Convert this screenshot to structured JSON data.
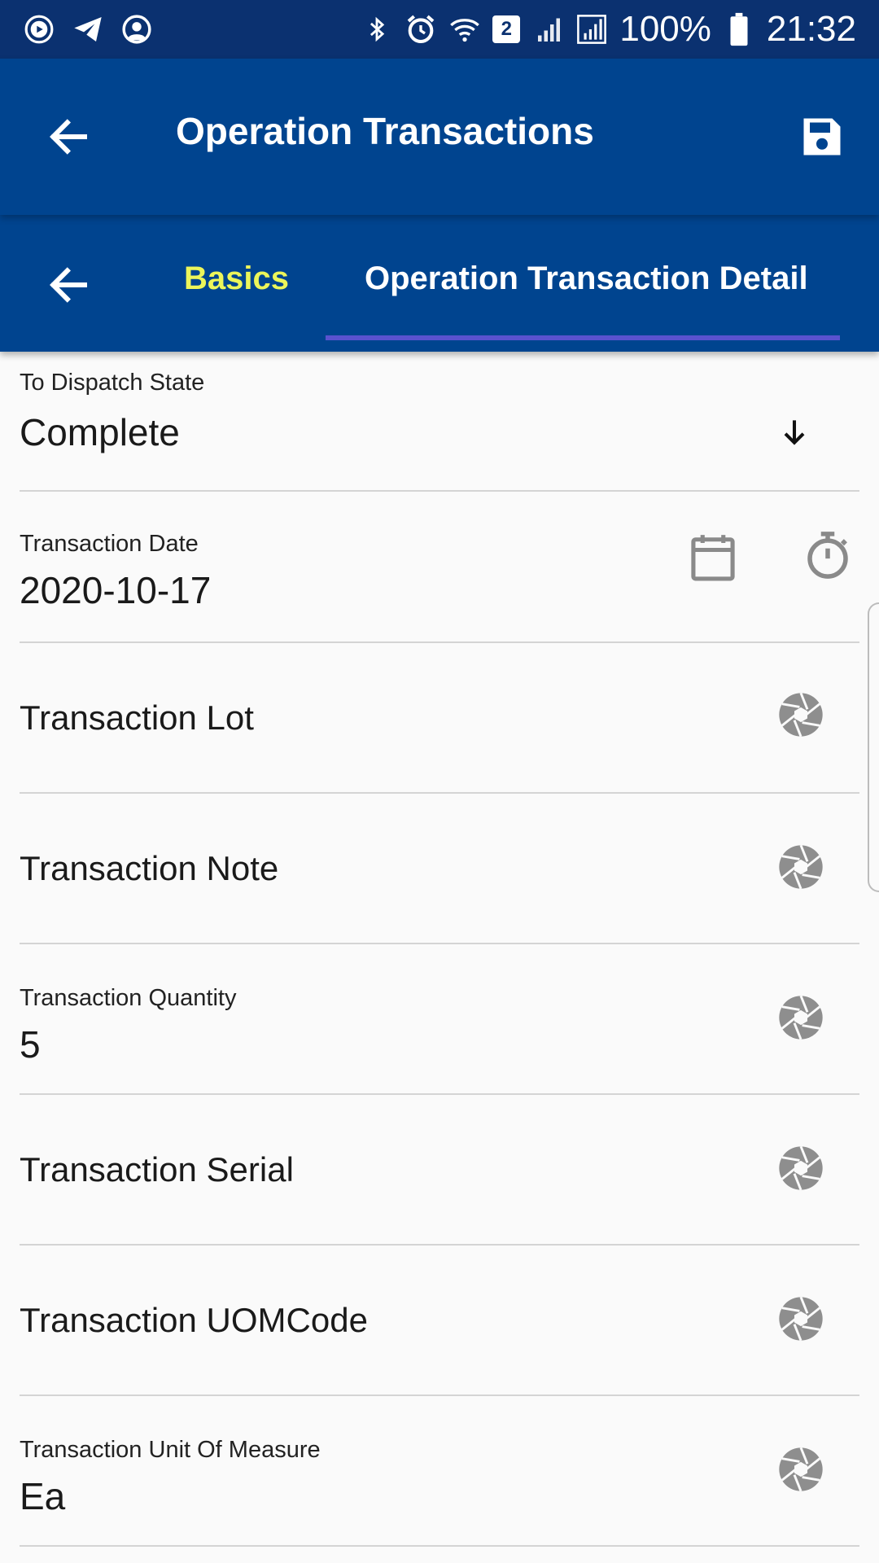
{
  "status_bar": {
    "notification_icons": [
      "play-circle-icon",
      "send-icon",
      "account-circle-icon"
    ],
    "system_icons": [
      "bluetooth-icon",
      "alarm-icon",
      "wifi-icon",
      "sim-icon",
      "signal-icon",
      "signal-roaming-icon"
    ],
    "sim_number": "2",
    "battery": "100%",
    "time": "21:32"
  },
  "app_bar": {
    "title": "Operation Transactions",
    "back_icon": "arrow-back-icon",
    "save_icon": "save-icon",
    "color": "#00448f"
  },
  "tabs": {
    "items": [
      {
        "label": "Basics",
        "color": "#ecf55a"
      },
      {
        "label": "Operation Transaction Detail",
        "color": "#ffffff",
        "selected": true
      }
    ],
    "indicator_color": "#5a52cf"
  },
  "form": {
    "fields": [
      {
        "label": "To Dispatch State",
        "value": "Complete",
        "icon": "arrow-down-icon"
      },
      {
        "label": "Transaction Date",
        "value": "2020-10-17",
        "icons": [
          "calendar-icon",
          "timer-icon"
        ]
      },
      {
        "label": "Transaction Lot",
        "value": "",
        "icon": "camera-shutter-icon"
      },
      {
        "label": "Transaction Note",
        "value": "",
        "icon": "camera-shutter-icon"
      },
      {
        "label": "Transaction Quantity",
        "value": "5",
        "icon": "camera-shutter-icon"
      },
      {
        "label": "Transaction Serial",
        "value": "",
        "icon": "camera-shutter-icon"
      },
      {
        "label": "Transaction UOMCode",
        "value": "",
        "icon": "camera-shutter-icon"
      },
      {
        "label": "Transaction Unit Of Measure",
        "value": "Ea",
        "icon": "camera-shutter-icon"
      }
    ]
  }
}
